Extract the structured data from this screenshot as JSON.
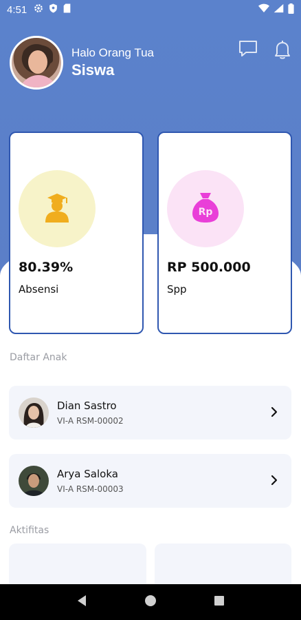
{
  "status_bar": {
    "time": "4:51"
  },
  "header": {
    "greeting": "Halo Orang Tua",
    "name": "Siswa"
  },
  "stats": [
    {
      "value": "80.39%",
      "label": "Absensi",
      "icon": "graduate-icon",
      "circle_color": "#f7f3c9",
      "icon_color": "#f0ad1e"
    },
    {
      "value": "RP 500.000",
      "label": "Spp",
      "icon": "money-bag-icon",
      "circle_color": "#fbe3f6",
      "icon_color": "#e93fd8",
      "icon_text": "Rp"
    }
  ],
  "children_section": {
    "title": "Daftar Anak",
    "children": [
      {
        "name": "Dian Sastro",
        "class": "VI-A RSM-00002"
      },
      {
        "name": "Arya Saloka",
        "class": "VI-A RSM-00003"
      }
    ]
  },
  "activities_section": {
    "title": "Aktifitas"
  },
  "colors": {
    "accent": "#5b82cc",
    "card_border": "#2f57b0",
    "card_bg": "#f3f5fb"
  }
}
